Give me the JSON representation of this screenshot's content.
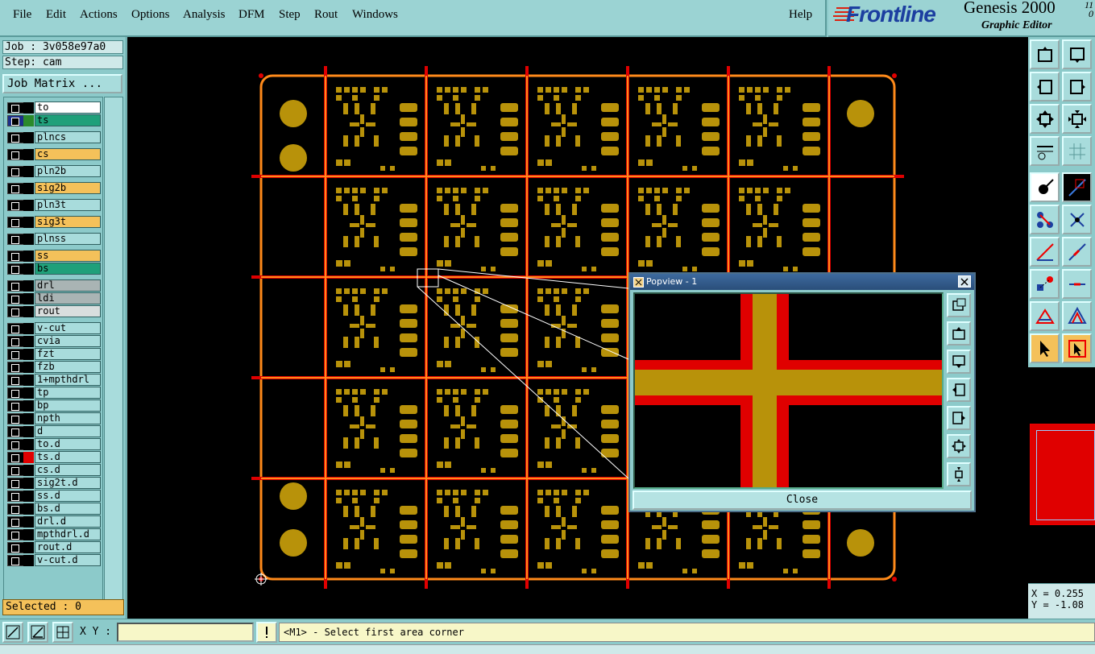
{
  "menu": {
    "items": [
      "File",
      "Edit",
      "Actions",
      "Options",
      "Analysis",
      "DFM",
      "Step",
      "Rout",
      "Windows"
    ],
    "help": "Help"
  },
  "brand": {
    "logo_text": "Frontline",
    "product": "Genesis 2000",
    "subtitle": "Graphic Editor",
    "version_top": "11",
    "version_bottom": "0"
  },
  "job": {
    "job_label": "Job : 3v058e97a0",
    "step_label": "Step: cam",
    "matrix_button": "Job Matrix ..."
  },
  "layers": [
    {
      "name": "to",
      "color": "#ffffff",
      "marker": ""
    },
    {
      "name": "ts",
      "color": "#1fa07a",
      "marker": "#2b8a2b",
      "active": true
    },
    {
      "name": "plncs",
      "color": "#a8dcdc",
      "marker": ""
    },
    {
      "name": "cs",
      "color": "#f4c15a",
      "marker": ""
    },
    {
      "name": "pln2b",
      "color": "#a8dcdc",
      "marker": ""
    },
    {
      "name": "sig2b",
      "color": "#f4c15a",
      "marker": ""
    },
    {
      "name": "pln3t",
      "color": "#a8dcdc",
      "marker": ""
    },
    {
      "name": "sig3t",
      "color": "#f4c15a",
      "marker": ""
    },
    {
      "name": "plnss",
      "color": "#a8dcdc",
      "marker": ""
    },
    {
      "name": "ss",
      "color": "#f4c15a",
      "marker": ""
    },
    {
      "name": "bs",
      "color": "#1fa07a",
      "marker": ""
    },
    {
      "name": "drl",
      "color": "#a9b4b4",
      "marker": ""
    },
    {
      "name": "ldi",
      "color": "#a9b4b4",
      "marker": ""
    },
    {
      "name": "rout",
      "color": "#d9dede",
      "marker": ""
    },
    {
      "name": "v-cut",
      "color": "#a8dcdc",
      "marker": ""
    },
    {
      "name": "cvia",
      "color": "#a8dcdc",
      "marker": ""
    },
    {
      "name": "fzt",
      "color": "#a8dcdc",
      "marker": ""
    },
    {
      "name": "fzb",
      "color": "#a8dcdc",
      "marker": ""
    },
    {
      "name": "1+mpthdrl",
      "color": "#a8dcdc",
      "marker": ""
    },
    {
      "name": "tp",
      "color": "#a8dcdc",
      "marker": ""
    },
    {
      "name": "bp",
      "color": "#a8dcdc",
      "marker": ""
    },
    {
      "name": "npth",
      "color": "#a8dcdc",
      "marker": ""
    },
    {
      "name": "d",
      "color": "#a8dcdc",
      "marker": ""
    },
    {
      "name": "to.d",
      "color": "#a8dcdc",
      "marker": ""
    },
    {
      "name": "ts.d",
      "color": "#a8dcdc",
      "marker": "#e00000"
    },
    {
      "name": "cs.d",
      "color": "#a8dcdc",
      "marker": ""
    },
    {
      "name": "sig2t.d",
      "color": "#a8dcdc",
      "marker": ""
    },
    {
      "name": "ss.d",
      "color": "#a8dcdc",
      "marker": ""
    },
    {
      "name": "bs.d",
      "color": "#a8dcdc",
      "marker": ""
    },
    {
      "name": "drl.d",
      "color": "#a8dcdc",
      "marker": ""
    },
    {
      "name": "mpthdrl.d",
      "color": "#a8dcdc",
      "marker": ""
    },
    {
      "name": "rout.d",
      "color": "#a8dcdc",
      "marker": ""
    },
    {
      "name": "v-cut.d",
      "color": "#a8dcdc",
      "marker": ""
    }
  ],
  "selected": "Selected : 0",
  "popview": {
    "title": "Popview - 1",
    "close": "Close"
  },
  "coords": {
    "x": "X = 0.255",
    "y": "Y = -1.08"
  },
  "bottom": {
    "xy_label": "X Y :",
    "xy_value": "",
    "message": "<M1> - Select first area corner"
  },
  "colors": {
    "pad": "#b8920a",
    "outline": "#ff8a1a",
    "route": "#e00000",
    "canvas": "#000000"
  }
}
